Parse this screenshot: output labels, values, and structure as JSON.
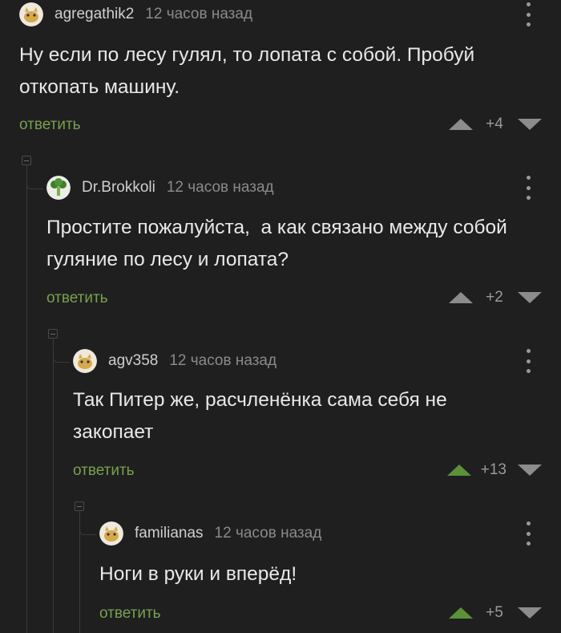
{
  "comments": [
    {
      "author": "agregathik2",
      "time": "12 часов назад",
      "text": "Ну если по лесу гулял, то лопата с собой. Пробуй откопать машину.",
      "reply": "ответить",
      "score": "+4",
      "vote": "none",
      "avatar": "cat-avatar-icon"
    },
    {
      "author": "Dr.Brokkoli",
      "time": "12 часов назад",
      "text": "Простите пожалуйста,  а как связано между собой гуляние по лесу и лопата?",
      "reply": "ответить",
      "score": "+2",
      "vote": "none",
      "avatar": "broccoli-avatar-icon"
    },
    {
      "author": "agv358",
      "time": "12 часов назад",
      "text": "Так Питер же, расчленёнка сама себя не закопает",
      "reply": "ответить",
      "score": "+13",
      "vote": "up",
      "avatar": "cat-avatar-icon"
    },
    {
      "author": "familianas",
      "time": "12 часов назад",
      "text": "Ноги в руки и вперёд!",
      "reply": "ответить",
      "score": "+5",
      "vote": "up",
      "avatar": "cat-avatar-icon"
    }
  ],
  "colors": {
    "background": "#1f1f20",
    "reply": "#78a14c",
    "upvote_active": "#5b9238",
    "vote_idle": "#8c8c8c"
  }
}
